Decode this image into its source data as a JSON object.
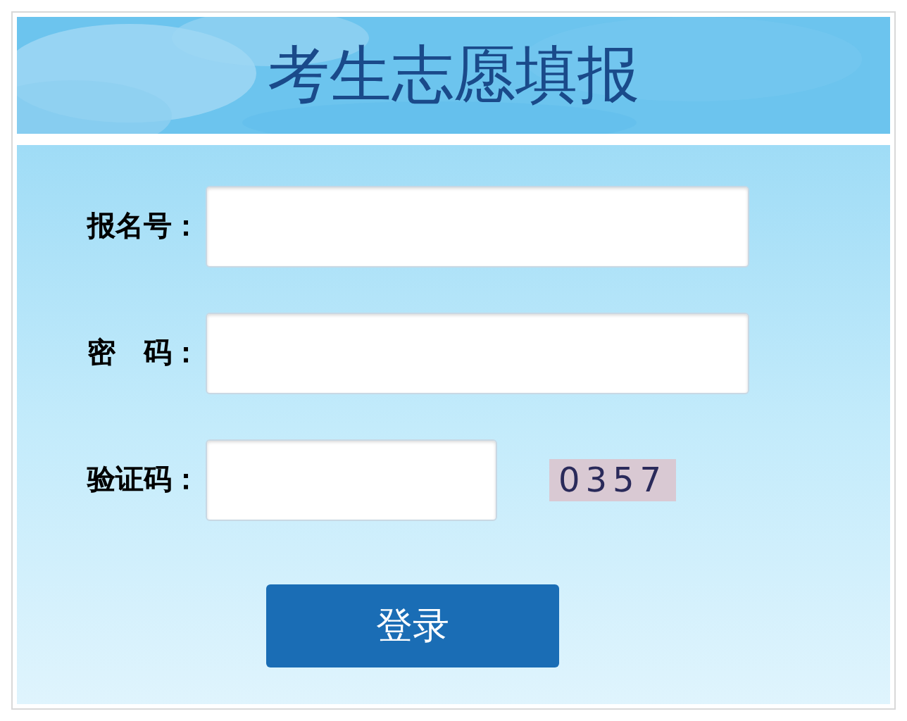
{
  "header": {
    "title": "考生志愿填报"
  },
  "fields": [
    {
      "label": "报名号：",
      "kind": "text"
    },
    {
      "label": "密　码：",
      "kind": "password"
    },
    {
      "label": "验证码：",
      "kind": "captcha",
      "code": "0357"
    }
  ],
  "submit": {
    "label": "登录"
  }
}
